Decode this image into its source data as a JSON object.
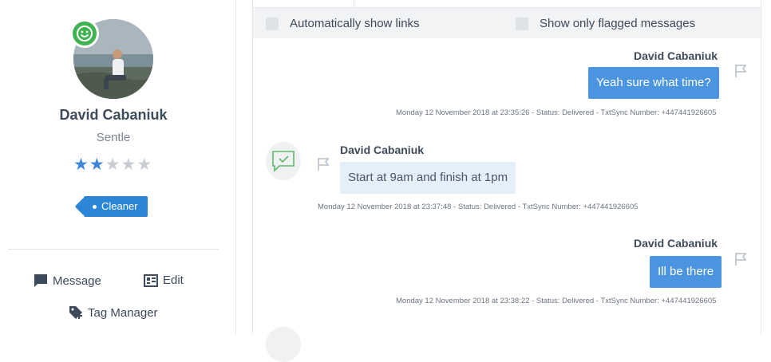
{
  "profile": {
    "name": "David Cabaniuk",
    "city": "Sentle",
    "rating": 2,
    "rating_max": 5,
    "tag": "Cleaner",
    "status_color": "#3fb34f"
  },
  "actions": {
    "message": "Message",
    "edit": "Edit",
    "tag_manager": "Tag Manager"
  },
  "options": {
    "auto_links": "Automatically show links",
    "flagged_only": "Show only flagged messages"
  },
  "messages": [
    {
      "direction": "outgoing",
      "sender": "David Cabaniuk",
      "text": "Yeah sure what time?",
      "meta": "Monday 12 November 2018 at 23:35:26 - Status: Delivered - TxtSync Number: +447441926605"
    },
    {
      "direction": "incoming",
      "sender": "David Cabaniuk",
      "text": "Start at 9am and finish at 1pm",
      "meta": "Monday 12 November 2018 at 23:37:48 - Status: Delivered - TxtSync Number: +447441926605"
    },
    {
      "direction": "outgoing",
      "sender": "David Cabaniuk",
      "text": "Ill be there",
      "meta": "Monday 12 November 2018 at 23:38:22 - Status: Delivered - TxtSync Number: +447441926605"
    }
  ],
  "colors": {
    "accent": "#2c86d8",
    "bubble_out": "#4a94e0",
    "bubble_in": "#e5effa",
    "star_on": "#3f86d6",
    "star_off": "#c8cdd4"
  }
}
